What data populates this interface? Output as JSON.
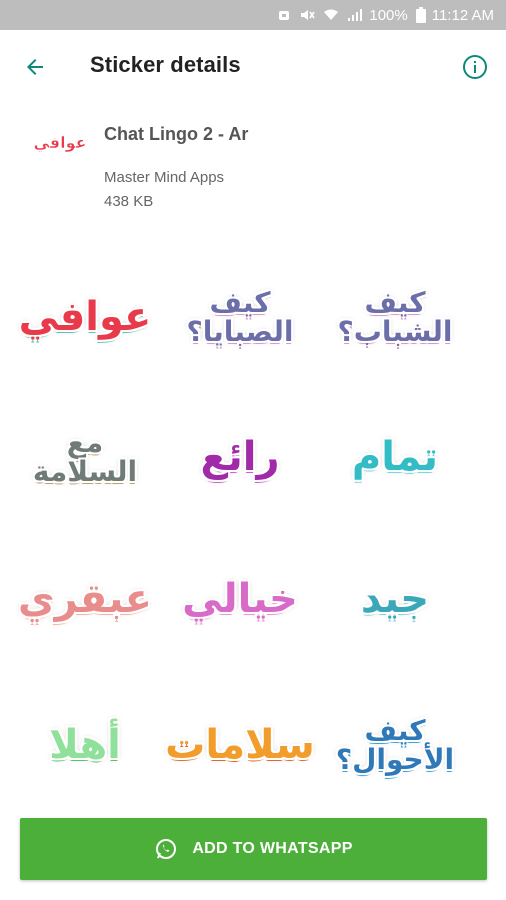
{
  "status_bar": {
    "battery": "100%",
    "time": "11:12 AM",
    "icons": [
      "alarm-icon",
      "mute-icon",
      "wifi-icon",
      "signal-icon",
      "battery-icon"
    ]
  },
  "app_bar": {
    "title": "Sticker details",
    "back_icon": "arrow-left-icon",
    "info_icon": "info-icon",
    "accent_color": "#0b8a7c"
  },
  "pack": {
    "name": "Chat Lingo 2 - Ar",
    "publisher": "Master Mind Apps",
    "size": "438 KB",
    "thumbnail_text": "عوافي"
  },
  "stickers": [
    {
      "text": "عوافي",
      "color": "#e83a4a",
      "second": "#5fc2b8"
    },
    {
      "text": "كيف الصبايا؟",
      "color": "#6b6ea8",
      "second": "#d79bc8"
    },
    {
      "text": "كيف الشباب؟",
      "color": "#6b6ea8",
      "second": "#d79bc8"
    },
    {
      "text": "مع السلامة",
      "color": "#707b78",
      "second": "#c5a06a"
    },
    {
      "text": "رائع",
      "color": "#a02aa8",
      "second": "#d25bd6"
    },
    {
      "text": "تمام",
      "color": "#32bcc6",
      "second": "#7ad6dc"
    },
    {
      "text": "عبقري",
      "color": "#e88c8c",
      "second": "#f3b4a0"
    },
    {
      "text": "خيالي",
      "color": "#d96bc8",
      "second": "#e89ad8"
    },
    {
      "text": "جيد",
      "color": "#3aa8b8",
      "second": "#8fd1da"
    },
    {
      "text": "أهلا",
      "color": "#8fe09a",
      "second": "#5ac26a"
    },
    {
      "text": "سلامات",
      "color": "#f29c2c",
      "second": "#e36a1e"
    },
    {
      "text": "كيف الأحوال؟",
      "color": "#2f79b8",
      "second": "#3aa6d8"
    }
  ],
  "add_button": {
    "label": "ADD TO WHATSAPP",
    "color": "#4caf3a",
    "icon": "whatsapp-icon"
  }
}
